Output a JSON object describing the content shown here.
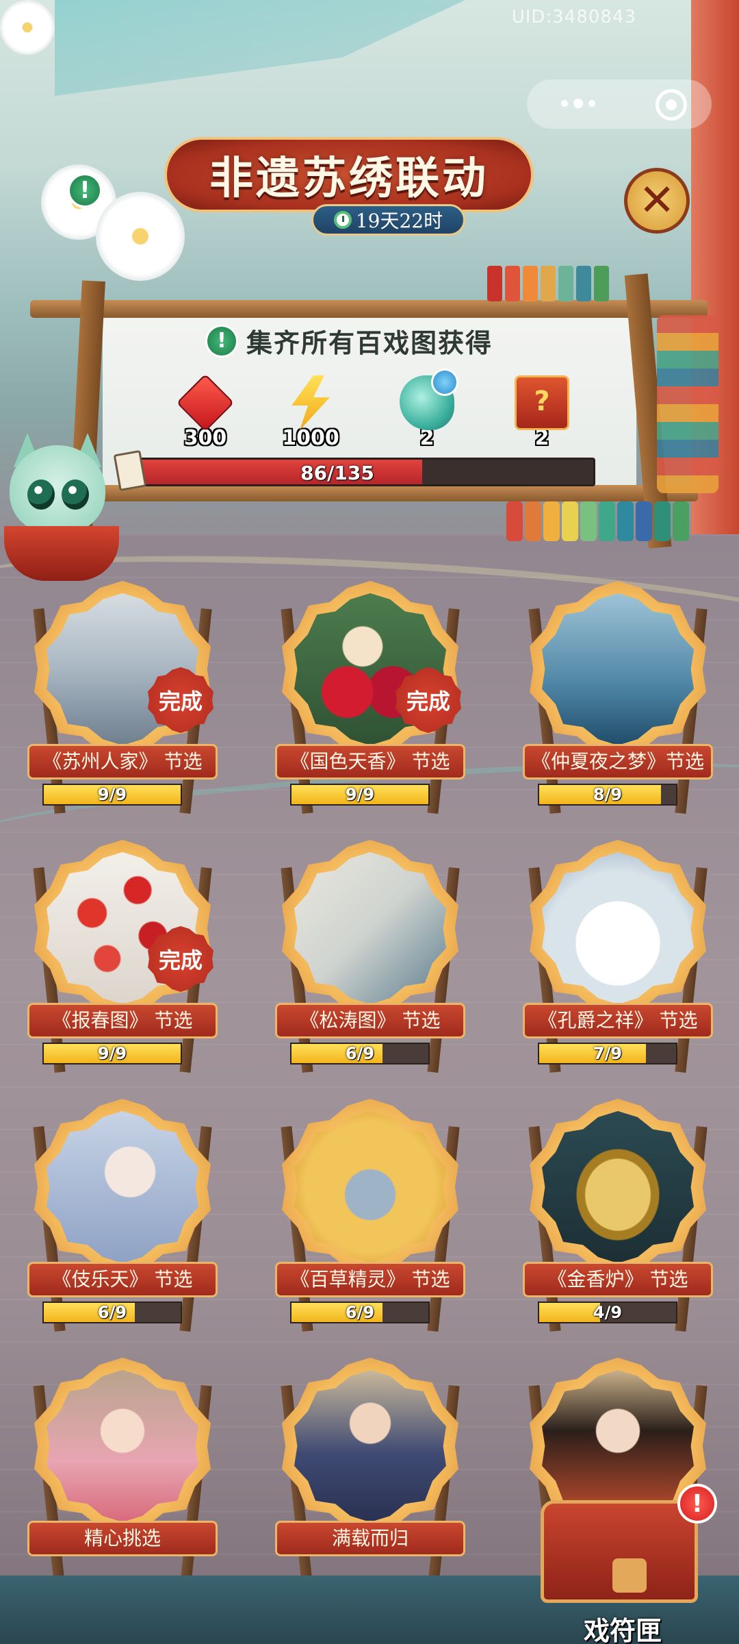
{
  "header": {
    "uid": "UID:3480843",
    "title": "非遗苏绣联动",
    "timer": "19天22时"
  },
  "loom": {
    "collect_text": "集齐所有百戏图获得",
    "rewards": [
      {
        "icon": "red-gem-icon",
        "count": "300"
      },
      {
        "icon": "lightning-icon",
        "count": "1000"
      },
      {
        "icon": "teal-gourd-icon",
        "count": "2"
      },
      {
        "icon": "mystery-chest-icon",
        "count": "2"
      }
    ],
    "progress": {
      "current": 86,
      "total": 135,
      "text": "86/135"
    }
  },
  "cards": [
    {
      "label": "《苏州人家》 节选",
      "progress": "9/9",
      "fraction": 1.0,
      "done": true
    },
    {
      "label": "《国色天香》 节选",
      "progress": "9/9",
      "fraction": 1.0,
      "done": true
    },
    {
      "label": "《仲夏夜之梦》节选",
      "progress": "8/9",
      "fraction": 0.889,
      "done": false
    },
    {
      "label": "《报春图》 节选",
      "progress": "9/9",
      "fraction": 1.0,
      "done": true
    },
    {
      "label": "《松涛图》 节选",
      "progress": "6/9",
      "fraction": 0.667,
      "done": false
    },
    {
      "label": "《孔爵之祥》 节选",
      "progress": "7/9",
      "fraction": 0.778,
      "done": false
    },
    {
      "label": "《伎乐天》 节选",
      "progress": "6/9",
      "fraction": 0.667,
      "done": false
    },
    {
      "label": "《百草精灵》 节选",
      "progress": "6/9",
      "fraction": 0.667,
      "done": false
    },
    {
      "label": "《金香炉》 节选",
      "progress": "4/9",
      "fraction": 0.444,
      "done": false
    },
    {
      "label": "精心挑选",
      "progress": "",
      "fraction": null,
      "done": false
    },
    {
      "label": "满载而归",
      "progress": "",
      "fraction": null,
      "done": false
    },
    {
      "label": "",
      "progress": "",
      "fraction": null,
      "done": false
    }
  ],
  "done_label": "完成",
  "chest_button": {
    "label": "戏符匣",
    "alert": "!"
  }
}
